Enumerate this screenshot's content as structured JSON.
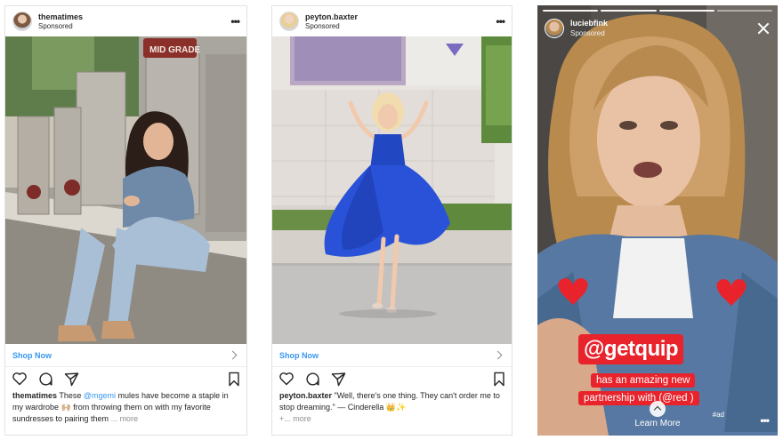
{
  "post1": {
    "username": "thematimes",
    "sponsored": "Sponsored",
    "more_icon": "more-horizontal-icon",
    "photo_sign": "MID GRADE",
    "cta_label": "Shop Now",
    "caption": {
      "user": "thematimes",
      "text_1": " These ",
      "mention": "@mgemi",
      "text_2": " mules have become a staple in my wardrobe 🙌🏼 from throwing them on with my favorite sundresses to pairing them",
      "more": " ... more"
    }
  },
  "post2": {
    "username": "peyton.baxter",
    "sponsored": "Sponsored",
    "more_icon": "more-horizontal-icon",
    "cta_label": "Shop Now",
    "caption": {
      "user": "peyton.baxter",
      "text": " \"Well, there's one thing. They can't order me to stop dreaming.\" — Cinderella 👑✨",
      "more_prefix": "+",
      "more": "... more"
    }
  },
  "story": {
    "username": "luciebfink",
    "sponsored": "Sponsored",
    "sticker_big": "@getquip",
    "sticker_line1": "has an amazing new",
    "sticker_line2": "partnership with (@red )",
    "ad_tag": "#ad",
    "learn_more": "Learn More",
    "more_dots": "•••"
  },
  "colors": {
    "link_blue": "#3897f0",
    "sticker_red": "#e8232b",
    "text_dark": "#262626"
  }
}
